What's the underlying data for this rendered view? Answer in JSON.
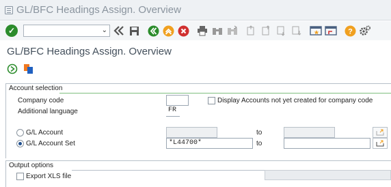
{
  "window": {
    "title": "GL/BFC Headings Assign. Overview"
  },
  "toolbar": {
    "command_field_value": "",
    "icons": [
      "ok-icon",
      "back-double-icon",
      "save-icon",
      "back-icon",
      "exit-icon",
      "cancel-icon",
      "print-icon",
      "find-icon",
      "find-next-icon",
      "first-page-icon",
      "prev-page-icon",
      "next-page-icon",
      "last-page-icon",
      "new-session-icon",
      "shortcut-icon",
      "help-icon",
      "settings-icon"
    ]
  },
  "page": {
    "heading": "GL/BFC Headings Assign. Overview"
  },
  "app_toolbar": {
    "icons": [
      "execute-icon",
      "variant-icon"
    ]
  },
  "account_selection": {
    "header": "Account selection",
    "company_code_label": "Company code",
    "company_code_value": "",
    "display_accounts_label": "Display Accounts not yet created for company code",
    "additional_language_label": "Additional language",
    "additional_language_value": "FR",
    "gl_account_label": "G/L Account",
    "gl_account_from": "",
    "gl_account_to": "",
    "gl_account_set_label": "G/L Account Set",
    "gl_account_set_from": "*L44700*",
    "gl_account_set_to": "",
    "to_label": "to"
  },
  "output_options": {
    "header": "Output options",
    "export_xls_label": "Export XLS file",
    "export_xls_value": ""
  },
  "colors": {
    "ok_green": "#2c8c2c",
    "accent_blue": "#1f4f8f",
    "orange": "#f0a020",
    "red": "#d03030"
  }
}
